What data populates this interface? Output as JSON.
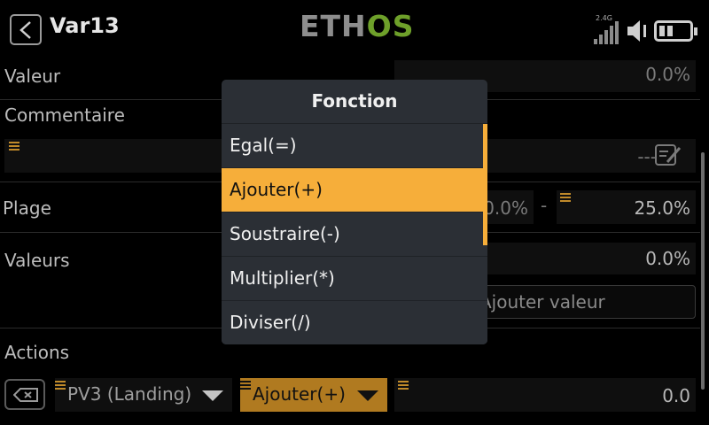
{
  "header": {
    "title": "Var13",
    "logo_left": "ETH",
    "logo_right": "OS",
    "band": "2.4G"
  },
  "form": {
    "valeur_label": "Valeur",
    "valeur_value": "0.0%",
    "commentaire_label": "Commentaire",
    "commentaire_value": "---",
    "plage_label": "Plage",
    "plage_min": "0.0%",
    "plage_dash": "-",
    "plage_max": "25.0%",
    "valeurs_label": "Valeurs",
    "valeurs_value": "0.0%",
    "ajouter_valeur": "Ajouter valeur",
    "actions_label": "Actions",
    "action_source": "PV3 (Landing)",
    "action_function": "Ajouter(+)",
    "action_value": "0.0"
  },
  "modal": {
    "title": "Fonction",
    "options": [
      {
        "label": "Egal(=)",
        "selected": false
      },
      {
        "label": "Ajouter(+)",
        "selected": true
      },
      {
        "label": "Soustraire(-)",
        "selected": false
      },
      {
        "label": "Multiplier(*)",
        "selected": false
      },
      {
        "label": "Diviser(/)",
        "selected": false
      }
    ]
  },
  "colors": {
    "accent": "#f6ae3a",
    "modal_bg": "#2b2f35",
    "logo_green": "#6ea02a"
  }
}
